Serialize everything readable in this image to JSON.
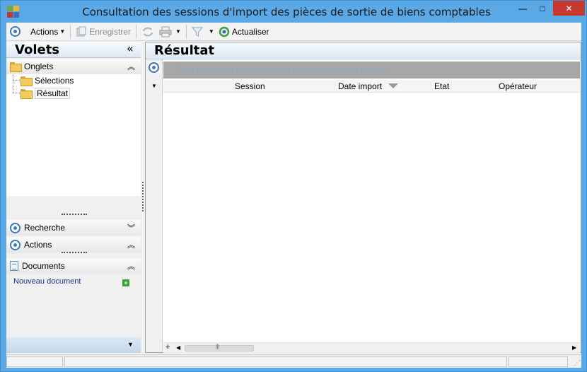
{
  "window": {
    "title": "Consultation des sessions d'import des pièces de sortie de biens comptables",
    "minimize": "—",
    "maximize": "□",
    "close": "✕"
  },
  "toolbar": {
    "actions_label": "Actions",
    "save_label": "Enregistrer",
    "refresh_label": "Actualiser"
  },
  "left_pane": {
    "title": "Volets",
    "collapse_glyph": "«",
    "sections": {
      "onglets": "Onglets",
      "recherche": "Recherche",
      "actions": "Actions",
      "documents": "Documents"
    },
    "tree": [
      "Sélections",
      "Résultat"
    ],
    "new_document": "Nouveau document"
  },
  "right_pane": {
    "title": "Résultat",
    "group_panel_text": "Faire glisser une colonne ici pour regrouper par cette colonne",
    "columns": [
      "Session",
      "Date import",
      "Etat",
      "Opérateur"
    ]
  },
  "colors": {
    "titlebar": "#5aa9e6",
    "close_button": "#c7382f",
    "accent_blue": "#3e78b7"
  }
}
